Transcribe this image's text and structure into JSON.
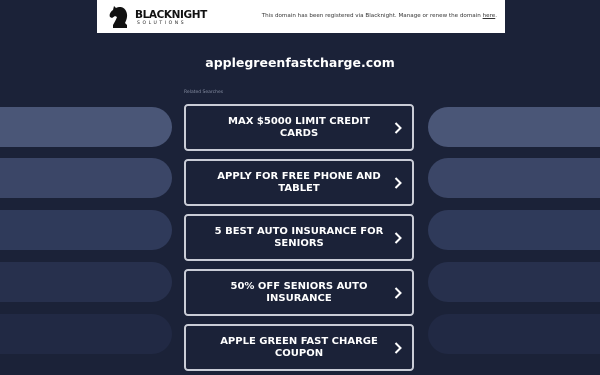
{
  "header": {
    "logo_name": "BLACKNIGHT",
    "logo_sub": "SOLUTIONS",
    "notice_text": "This domain has been registered via Blacknight. Manage or renew the domain ",
    "notice_link": "here",
    "notice_end": "."
  },
  "main": {
    "domain": "applegreenfastcharge.com",
    "related_label": "Related Searches",
    "searches": [
      {
        "label": "MAX $5000 LIMIT CREDIT CARDS"
      },
      {
        "label": "APPLY FOR FREE PHONE AND TABLET"
      },
      {
        "label": "5 BEST AUTO INSURANCE FOR SENIORS"
      },
      {
        "label": "50% OFF SENIORS AUTO INSURANCE"
      },
      {
        "label": "APPLE GREEN FAST CHARGE COUPON"
      }
    ]
  },
  "icons": [
    "blacknight-horse-logo",
    "chevron-right-icon"
  ],
  "colors": {
    "background": "#1b2238",
    "header_bg": "#ffffff",
    "button_border": "#c9ccd6",
    "text": "#ffffff"
  }
}
